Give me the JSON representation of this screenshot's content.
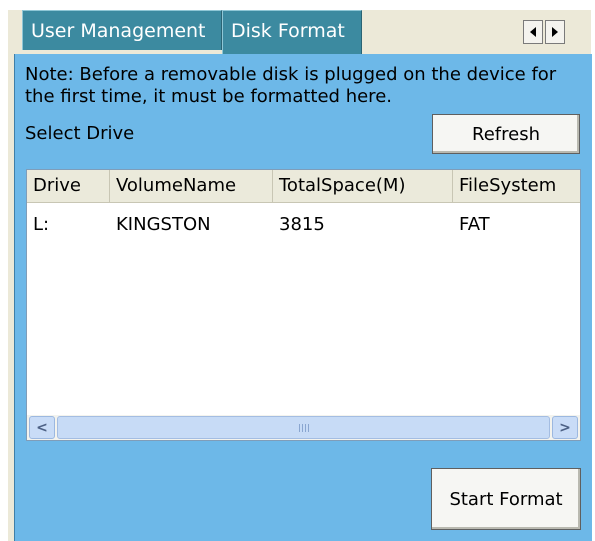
{
  "tabs": [
    {
      "label": "User Management",
      "active": false
    },
    {
      "label": "Disk Format",
      "active": true
    }
  ],
  "note": "Note: Before a removable disk is plugged on the device for the first time,  it must be formatted here.",
  "select_drive_label": "Select Drive",
  "refresh_label": "Refresh",
  "table": {
    "columns": [
      "Drive",
      "VolumeName",
      "TotalSpace(M)",
      "FileSystem"
    ],
    "rows": [
      [
        "L:",
        "KINGSTON",
        "3815",
        "FAT"
      ]
    ]
  },
  "start_format_label": "Start Format",
  "colors": {
    "panel": "#6db8e8",
    "tab": "#3c8aa0"
  }
}
